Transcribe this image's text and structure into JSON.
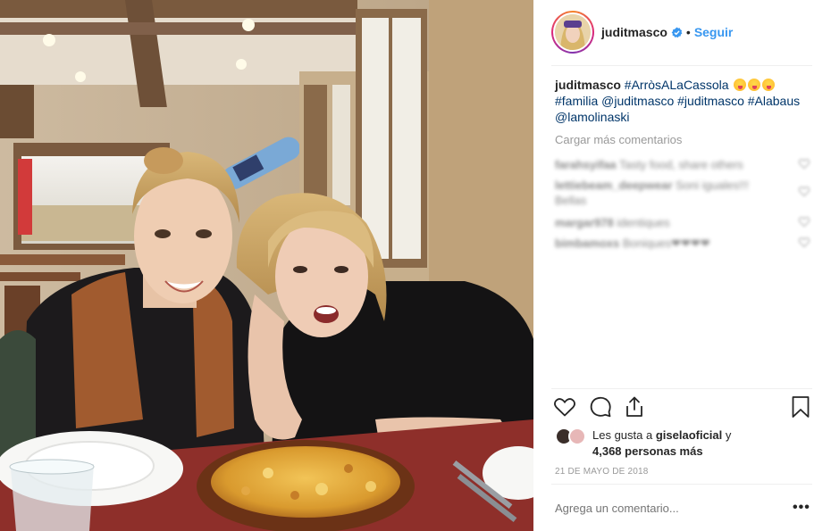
{
  "post": {
    "username": "juditmasco",
    "follow_label": "Seguir",
    "separator": "•",
    "caption": {
      "username": "juditmasco",
      "hashtag_1": "#ArròsALaCassola",
      "line_2_tags": "#familia @juditmasco #juditmasco #Alabaus",
      "line_3_tags": "@lamolinaski"
    },
    "load_more_label": "Cargar más comentarios",
    "comments": [
      {
        "user": "farahsyifaa",
        "text": "Tasty food, share others"
      },
      {
        "user": "lettiebeam_deepwear",
        "text": "Soni iguales!!!"
      },
      {
        "user": "",
        "text": "Bellas"
      },
      {
        "user": "margar978",
        "text": "identiques"
      },
      {
        "user": "bimbamoxs",
        "text": "Boniques❤❤❤❤"
      }
    ],
    "likes": {
      "prefix": "Les gusta a",
      "liker": "giselaoficial",
      "conjunction": "y",
      "others": "4,368 personas más"
    },
    "date": "21 DE MAYO DE 2018",
    "comment_placeholder": "Agrega un comentario...",
    "more_options": "•••"
  },
  "icons": {
    "verified": "verified-badge-icon",
    "like": "heart-icon",
    "comment": "comment-bubble-icon",
    "share": "share-icon",
    "save": "bookmark-icon"
  },
  "colors": {
    "link": "#3897f0",
    "hashtag": "#003569",
    "muted": "#999999",
    "text": "#262626"
  }
}
